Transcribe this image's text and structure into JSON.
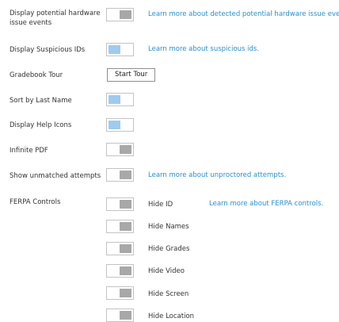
{
  "settings": {
    "hardware": {
      "label": "Display potential hardware issue events",
      "state": "off",
      "link": "Learn more about detected potential hardware issue events."
    },
    "suspicious": {
      "label": "Display Suspicious IDs",
      "state": "on",
      "link": "Learn more about suspicious ids."
    },
    "gradebook": {
      "label": "Gradebook Tour",
      "button": "Start Tour"
    },
    "sort_last_name": {
      "label": "Sort by Last Name",
      "state": "on"
    },
    "help_icons": {
      "label": "Display Help Icons",
      "state": "on"
    },
    "infinite_pdf": {
      "label": "Infinite PDF",
      "state": "off"
    },
    "unmatched": {
      "label": "Show unmatched attempts",
      "state": "off",
      "link": "Learn more about unproctored attempts."
    },
    "ferpa": {
      "label": "FERPA Controls",
      "link": "Learn more about FERPA controls.",
      "options": [
        {
          "label": "Hide ID",
          "state": "off"
        },
        {
          "label": "Hide Names",
          "state": "off"
        },
        {
          "label": "Hide Grades",
          "state": "off"
        },
        {
          "label": "Hide Video",
          "state": "off"
        },
        {
          "label": "Hide Screen",
          "state": "off"
        },
        {
          "label": "Hide Location",
          "state": "off"
        }
      ]
    }
  },
  "colors": {
    "link": "#2a8fd2",
    "toggle_on": "#9ecbef",
    "toggle_off": "#a8a8a8"
  }
}
